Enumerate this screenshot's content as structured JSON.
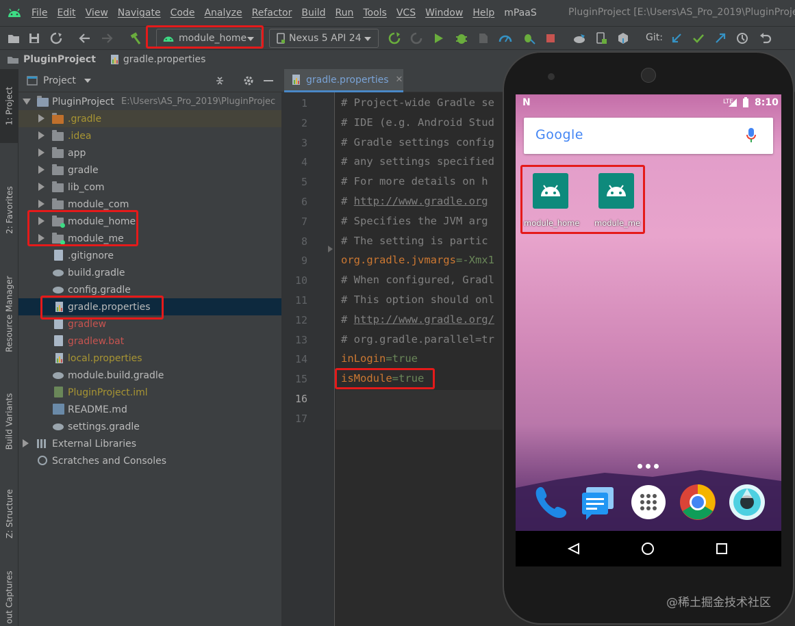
{
  "menu": {
    "items": [
      "File",
      "Edit",
      "View",
      "Navigate",
      "Code",
      "Analyze",
      "Refactor",
      "Build",
      "Run",
      "Tools",
      "VCS",
      "Window",
      "Help",
      "mPaaS"
    ],
    "window_title": "PluginProject [E:\\Users\\AS_Pro_2019\\PluginProjec"
  },
  "toolbar": {
    "run_config": "module_home",
    "device": "Nexus 5 API 24",
    "git_label": "Git:"
  },
  "breadcrumb": {
    "project": "PluginProject",
    "file": "gradle.properties"
  },
  "side_tabs": [
    "1: Project",
    "2: Favorites",
    "Resource Manager",
    "Build Variants",
    "Z: Structure",
    "out Captures"
  ],
  "project_panel": {
    "title": "Project",
    "root_label": "PluginProject",
    "root_path": "E:\\Users\\AS_Pro_2019\\PluginProjec",
    "items": [
      {
        "label": ".gradle"
      },
      {
        "label": ".idea"
      },
      {
        "label": "app"
      },
      {
        "label": "gradle"
      },
      {
        "label": "lib_com"
      },
      {
        "label": "module_com"
      },
      {
        "label": "module_home"
      },
      {
        "label": "module_me"
      },
      {
        "label": ".gitignore"
      },
      {
        "label": "build.gradle"
      },
      {
        "label": "config.gradle"
      },
      {
        "label": "gradle.properties"
      },
      {
        "label": "gradlew"
      },
      {
        "label": "gradlew.bat"
      },
      {
        "label": "local.properties"
      },
      {
        "label": "module.build.gradle"
      },
      {
        "label": "PluginProject.iml"
      },
      {
        "label": "README.md"
      },
      {
        "label": "settings.gradle"
      },
      {
        "label": "External Libraries"
      },
      {
        "label": "Scratches and Consoles"
      }
    ]
  },
  "editor": {
    "tab": "gradle.properties",
    "line_numbers": [
      "1",
      "2",
      "3",
      "4",
      "5",
      "6",
      "7",
      "8",
      "9",
      "10",
      "11",
      "12",
      "13",
      "14",
      "15",
      "16",
      "17"
    ],
    "lines": [
      "# Project-wide Gradle se",
      "# IDE (e.g. Android Stud",
      "# Gradle settings config",
      "# any settings specified",
      "# For more details on h",
      "http://www.gradle.org",
      "# Specifies the JVM arg",
      "# The setting is partic",
      "org.gradle.jvmargs",
      "=-Xmx1",
      "# When configured, Gradl",
      "# This option should onl",
      "http://www.gradle.org/",
      "# org.gradle.parallel=tr",
      "inLogin",
      "=true",
      "isModule",
      "=true"
    ]
  },
  "phone": {
    "time": "8:10",
    "lte": "LTE",
    "google": "Google",
    "apps": [
      "module_home",
      "module_me"
    ]
  },
  "watermark": "@稀土掘金技术社区"
}
